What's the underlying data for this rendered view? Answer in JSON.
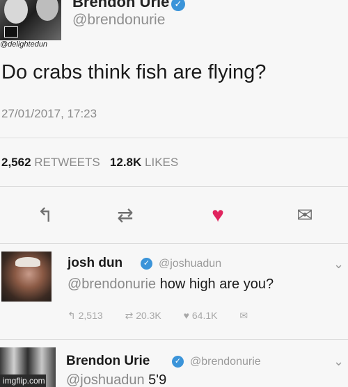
{
  "tweet": {
    "author_name": "Brendon Urie",
    "author_handle": "@brendonurie",
    "avatar_credit": "@delightedun",
    "text": "Do crabs think fish are flying?",
    "timestamp": "27/01/2017, 17:23",
    "retweets_count": "2,562",
    "retweets_label": "RETWEETS",
    "likes_count": "12.8K",
    "likes_label": "LIKES"
  },
  "actions": {
    "reply_icon": "reply-arrow-icon",
    "retweet_icon": "retweet-icon",
    "like_icon": "heart-icon",
    "dm_icon": "envelope-icon",
    "reply_glyph": "↰",
    "retweet_glyph": "⇄",
    "like_glyph": "♥",
    "dm_glyph": "✉"
  },
  "replies": [
    {
      "name": "josh dun",
      "handle": "@joshuadun",
      "mention": "@brendonurie",
      "text": "how high are you?",
      "reply_count": "2,513",
      "retweet_count": "20.3K",
      "like_count": "64.1K"
    },
    {
      "name": "Brendon Urie",
      "handle": "@brendonurie",
      "mention": "@joshuadun",
      "text": "5'9"
    }
  ],
  "watermark": "imgflip.com",
  "colors": {
    "verified": "#3b94d9",
    "like": "#e0245e",
    "muted_text": "#8a8a8a"
  }
}
